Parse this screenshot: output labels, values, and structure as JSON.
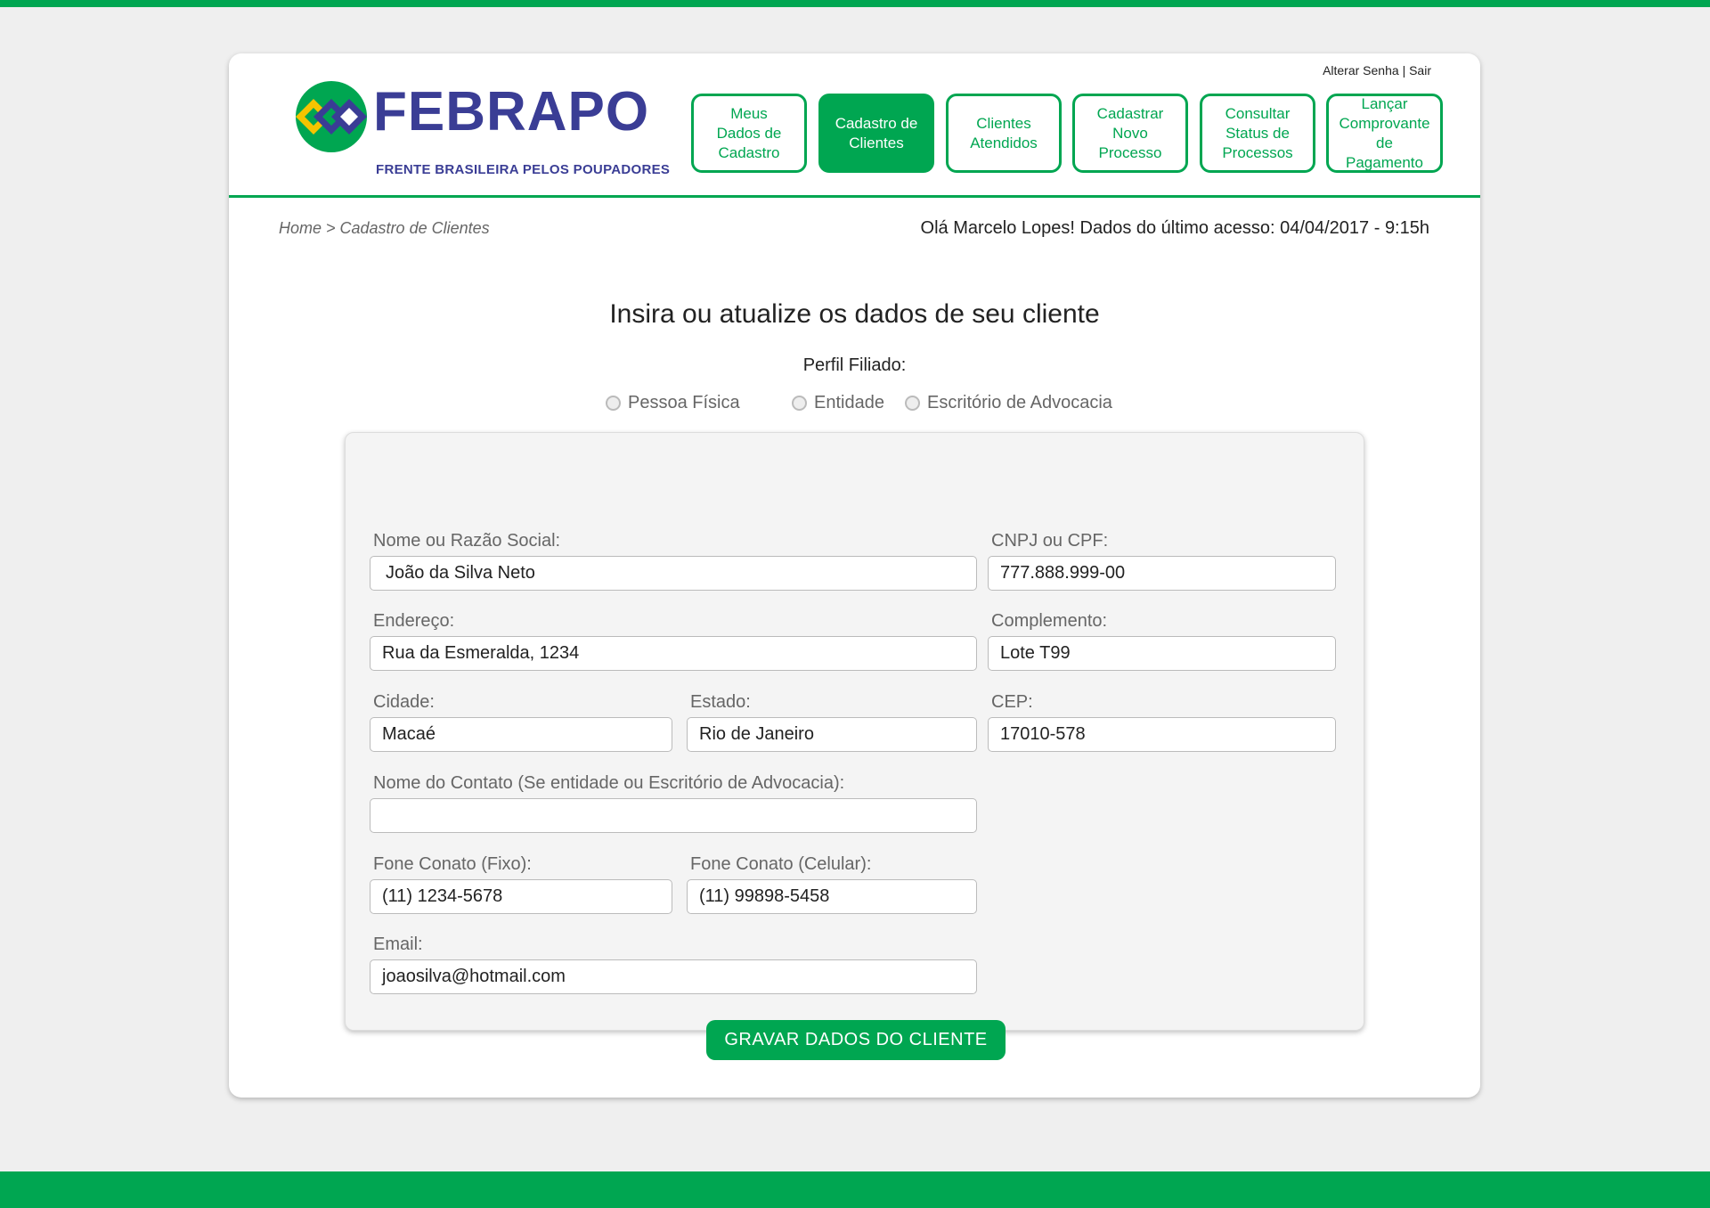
{
  "brand": {
    "name": "FEBRAPO",
    "tagline": "FRENTE BRASILEIRA PELOS POUPADORES",
    "green": "#00a651",
    "navy": "#3a3d95",
    "yellow": "#f5c400"
  },
  "account": {
    "change_password": "Alterar Senha",
    "separator": "|",
    "logout": "Sair"
  },
  "nav": [
    {
      "label_lines": [
        "Meus",
        "Dados de",
        "Cadastro"
      ],
      "active": false
    },
    {
      "label_lines": [
        "Cadastro de",
        "Clientes"
      ],
      "active": true
    },
    {
      "label_lines": [
        "Clientes",
        "Atendidos"
      ],
      "active": false
    },
    {
      "label_lines": [
        "Cadastrar",
        "Novo",
        "Processo"
      ],
      "active": false
    },
    {
      "label_lines": [
        "Consultar",
        "Status de",
        "Processos"
      ],
      "active": false
    },
    {
      "label_lines": [
        "Lançar",
        "Comprovante",
        "de Pagamento"
      ],
      "active": false
    }
  ],
  "breadcrumb": "Home > Cadastro de Clientes",
  "greeting": "Olá Marcelo Lopes! Dados do último acesso: 04/04/2017 - 9:15h",
  "form": {
    "title": "Insira ou atualize os dados de seu cliente",
    "profile_label": "Perfil Filiado:",
    "profiles": [
      "Pessoa Física",
      "Entidade",
      "Escritório de Advocacia"
    ],
    "fields": {
      "name": {
        "label": "Nome ou Razão Social:",
        "value": "João da Silva Neto"
      },
      "doc": {
        "label": "CNPJ ou CPF:",
        "value": "777.888.999-00"
      },
      "address": {
        "label": "Endereço:",
        "value": "Rua da Esmeralda, 1234"
      },
      "complement": {
        "label": "Complemento:",
        "value": "Lote T99"
      },
      "city": {
        "label": "Cidade:",
        "value": "Macaé"
      },
      "state": {
        "label": "Estado:",
        "value": "Rio de Janeiro"
      },
      "zip": {
        "label": "CEP:",
        "value": "17010-578"
      },
      "contact": {
        "label": "Nome do Contato (Se entidade ou Escritório de Advocacia):",
        "value": ""
      },
      "phone_fixed": {
        "label": "Fone Conato (Fixo):",
        "value": "(11) 1234-5678"
      },
      "phone_mobile": {
        "label": "Fone Conato (Celular):",
        "value": "(11) 99898-5458"
      },
      "email": {
        "label": "Email:",
        "value": "joaosilva@hotmail.com"
      }
    },
    "submit_label": "GRAVAR DADOS DO CLIENTE"
  }
}
